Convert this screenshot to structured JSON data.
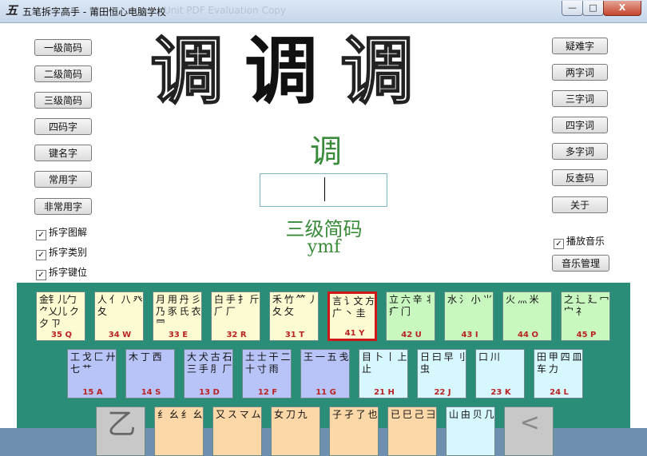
{
  "window": {
    "title": "五笔拆字高手 - 莆田恒心电脑学校",
    "title_ghost": "Unit PDF Evaluation Copy",
    "minimize": "—",
    "maximize": "□",
    "close": "X",
    "app_icon": "五"
  },
  "left_buttons": [
    "一级简码",
    "二级简码",
    "三级简码",
    "四码字",
    "键名字",
    "常用字",
    "非常用字"
  ],
  "right_buttons": [
    "疑难字",
    "两字词",
    "三字词",
    "四字词",
    "多字词",
    "反查码",
    "关于"
  ],
  "checkboxes": [
    {
      "label": "拆字图解",
      "checked": true
    },
    {
      "label": "拆字类别",
      "checked": true
    },
    {
      "label": "拆字键位",
      "checked": true
    }
  ],
  "music": {
    "label": "播放音乐",
    "checked": true,
    "manage": "音乐管理"
  },
  "display": {
    "big_chars": [
      "调",
      "调",
      "调"
    ],
    "char": "调",
    "input_value": "",
    "level": "三级简码",
    "code": "ymf"
  },
  "keyboard": {
    "row1": [
      {
        "glyphs": "金钅儿勹 ⺈乂儿 ク夕 ㄗ",
        "label": "35 Q"
      },
      {
        "glyphs": "人 亻 八 癶 夂",
        "label": "34 W"
      },
      {
        "glyphs": "月 用 丹 彡 乃 豕 氏 衣 ⺜",
        "label": "33 E"
      },
      {
        "glyphs": "白 手 扌 斤 ⺁ 厂",
        "label": "32 R"
      },
      {
        "glyphs": "禾 竹 ⺮ 丿 夂 攵",
        "label": "31 T"
      },
      {
        "glyphs": "言 讠文 方 广 丶 圭",
        "label": "41 Y"
      },
      {
        "glyphs": "立 六 辛 丬 疒 门",
        "label": "42 U"
      },
      {
        "glyphs": "水 氵 小 ⺌",
        "label": "43 I"
      },
      {
        "glyphs": "火 灬 米",
        "label": "44 O"
      },
      {
        "glyphs": "之 辶 廴 冖 宀 礻",
        "label": "45 P"
      }
    ],
    "row2": [
      {
        "glyphs": "工 戈 匚 廾 七 艹",
        "label": "15 A"
      },
      {
        "glyphs": "木 丁 西",
        "label": "14 S"
      },
      {
        "glyphs": "大 犬 古 石 三 手 ⺼ 厂",
        "label": "13 D"
      },
      {
        "glyphs": "土 士 干 二 十 寸 雨",
        "label": "12 F"
      },
      {
        "glyphs": "王 一 五 戋",
        "label": "11 G"
      },
      {
        "glyphs": "目 卜 丨 上 止",
        "label": "21 H"
      },
      {
        "glyphs": "日 曰 早 刂 虫",
        "label": "22 J"
      },
      {
        "glyphs": "口 川",
        "label": "23 K"
      },
      {
        "glyphs": "田 甲 四 皿 车 力",
        "label": "24 L"
      }
    ],
    "row3": [
      {
        "glyphs": "乙",
        "label": ""
      },
      {
        "glyphs": "纟 幺 纟 幺",
        "label": ""
      },
      {
        "glyphs": "又 ス マ ム",
        "label": ""
      },
      {
        "glyphs": "女 刀 九",
        "label": ""
      },
      {
        "glyphs": "子 孑 了 也",
        "label": ""
      },
      {
        "glyphs": "已 巳 己 ⺕",
        "label": ""
      },
      {
        "glyphs": "山 由 贝 几",
        "label": ""
      },
      {
        "glyphs": "<",
        "label": ""
      }
    ]
  }
}
